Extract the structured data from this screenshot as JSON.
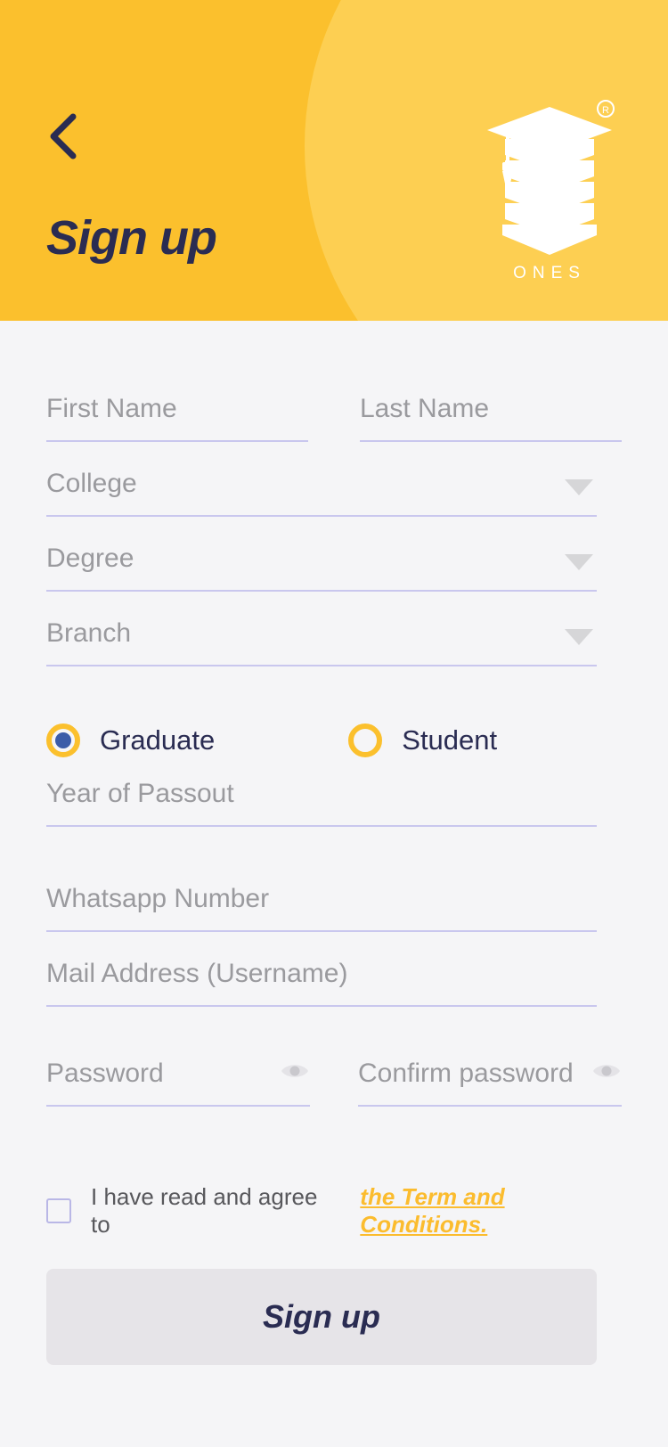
{
  "header": {
    "title": "Sign up",
    "back_icon": "chevron-left-icon",
    "brand": {
      "name": "ONES",
      "mark": "graduation-cap-pillar-logo",
      "trademark": "R"
    },
    "bg_color": "#fbc02d",
    "circle_color": "#fdcf52",
    "title_color": "#2a2c52"
  },
  "form": {
    "first_name": {
      "placeholder": "First Name"
    },
    "last_name": {
      "placeholder": "Last Name"
    },
    "college": {
      "placeholder": "College",
      "caret": "chevron-down-icon"
    },
    "degree": {
      "placeholder": "Degree",
      "caret": "chevron-down-icon"
    },
    "branch": {
      "placeholder": "Branch",
      "caret": "chevron-down-icon"
    },
    "role": {
      "options": [
        {
          "label": "Graduate",
          "selected": true
        },
        {
          "label": "Student",
          "selected": false
        }
      ],
      "ring_color": "#fbc02d",
      "dot_color": "#3b5ca8"
    },
    "year_of_passout": {
      "placeholder": "Year of Passout"
    },
    "whatsapp_number": {
      "placeholder": "Whatsapp Number"
    },
    "mail_address": {
      "placeholder": "Mail Address (Username)"
    },
    "password": {
      "placeholder": "Password",
      "toggle_icon": "eye-icon"
    },
    "confirm_password": {
      "placeholder": "Confirm password",
      "toggle_icon": "eye-icon"
    },
    "underline_color": "#c9c7ee",
    "placeholder_color": "#9a9a9e"
  },
  "terms": {
    "checkbox_checked": false,
    "text": "I have read and agree to",
    "link": "the Term and Conditions.",
    "link_color": "#fbbc2e"
  },
  "submit": {
    "label": "Sign up",
    "bg_color": "#e6e4e8",
    "text_color": "#2a2c52"
  }
}
